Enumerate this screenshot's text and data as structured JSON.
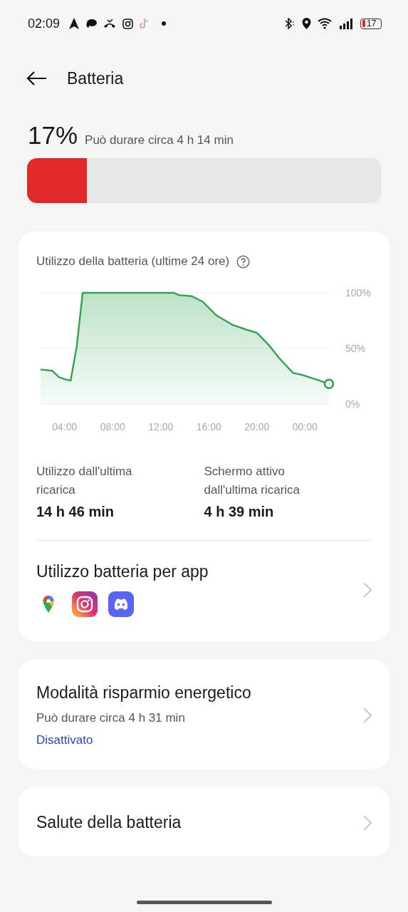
{
  "status_bar": {
    "time": "02:09",
    "battery": "17"
  },
  "header": {
    "title": "Batteria"
  },
  "battery": {
    "percent": "17%",
    "estimate": "Può durare circa 4 h 14 min",
    "level": 0.17
  },
  "usage_card": {
    "title": "Utilizzo della batteria (ultime 24 ore)",
    "chart_data": {
      "type": "area",
      "x": [
        2.0,
        2.95,
        3.55,
        4.1,
        4.5,
        5.0,
        5.5,
        13.1,
        13.5,
        14.6,
        15.5,
        16.6,
        18.0,
        19.1,
        20.0,
        21.0,
        21.8,
        23.0,
        23.8,
        25.2,
        26.0
      ],
      "series": [
        {
          "color": "#2ea44f",
          "values": [
            31,
            30,
            24,
            22,
            21,
            51,
            100,
            100,
            98,
            97,
            92,
            80,
            71,
            67,
            64,
            53,
            42,
            28,
            26,
            21,
            18
          ]
        }
      ],
      "xlim": [
        2,
        26
      ],
      "ylim": [
        0,
        100
      ],
      "xticks": [
        {
          "value": 4,
          "label": "04:00"
        },
        {
          "value": 8,
          "label": "08:00"
        },
        {
          "value": 12,
          "label": "12:00"
        },
        {
          "value": 16,
          "label": "16:00"
        },
        {
          "value": 20,
          "label": "20:00"
        },
        {
          "value": 24,
          "label": "00:00"
        }
      ],
      "yticks": [
        {
          "value": 100,
          "label": "100%"
        },
        {
          "value": 50,
          "label": "50%"
        },
        {
          "value": 0,
          "label": "0%"
        }
      ]
    },
    "stats": [
      {
        "label": "Utilizzo dall'ultima ricarica",
        "value": "14 h 46 min"
      },
      {
        "label": "Schermo attivo dall'ultima ricarica",
        "value": "4 h 39 min"
      }
    ],
    "per_app": {
      "title": "Utilizzo batteria per app"
    }
  },
  "saver": {
    "title": "Modalità risparmio energetico",
    "subtitle": "Può durare circa 4 h 31 min",
    "status": "Disattivato"
  },
  "health": {
    "title": "Salute della batteria"
  }
}
